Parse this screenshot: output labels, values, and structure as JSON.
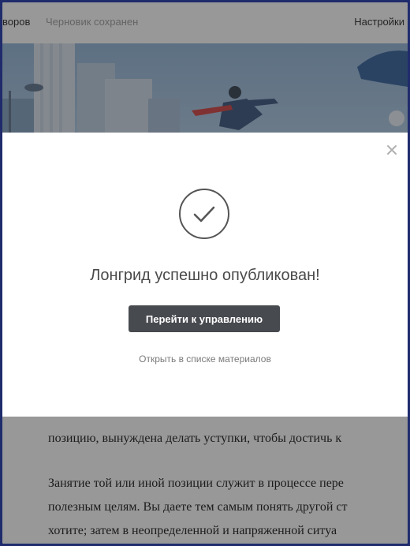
{
  "topbar": {
    "left_text": "воров",
    "draft_status": "Черновик сохранен",
    "settings_label": "Настройки"
  },
  "article": {
    "lines": [
      "позицию, вынуждена делать уступки, чтобы достичь к",
      "Занятие той или иной позиции служит в процессе пере",
      "полезным целям. Вы даете тем самым понять другой ст",
      "хотите; затем в неопределенной и напряженной ситуа"
    ]
  },
  "modal": {
    "title": "Лонгрид успешно опубликован!",
    "primary_button": "Перейти к управлению",
    "secondary_link": "Открыть в списке материалов",
    "check_icon": "check-circle-icon",
    "close_icon": "close-icon"
  },
  "colors": {
    "primary_button_bg": "#474a4f",
    "overlay": "rgba(40,40,40,0.48)",
    "frame_border": "#1f2b6b"
  }
}
